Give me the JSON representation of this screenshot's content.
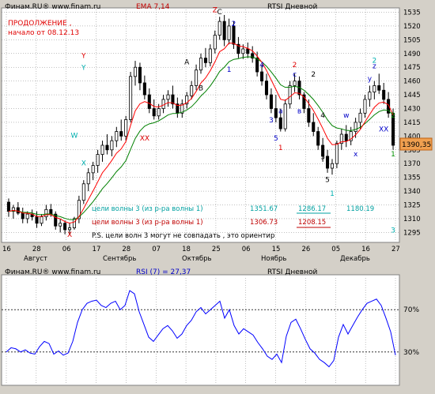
{
  "colors": {
    "panel_bg": "#ffffff",
    "outer_bg": "#d4d0c8",
    "grid": "#808080",
    "candle_stroke": "#000000",
    "candle_up_fill": "#ffffff",
    "ema_fast": "#ff0000",
    "ema_slow": "#008000",
    "rsi_line": "#0000ff",
    "wave_red": "#e00000",
    "wave_blue": "#0000c8",
    "wave_cyan": "#00b0b0",
    "wave_black": "#000000",
    "price_badge_bg": "#f0a050",
    "annotation_red": "#c00000",
    "annotation_cyan": "#00a0a0"
  },
  "price_panel": {
    "source_label": "Финам.RU® www.finam.ru",
    "indicator_label": "EMA 7,14",
    "title": "RTSI Дневной",
    "note_line1": "ПРОДОЛЖЕНИЕ  ,",
    "note_line2": "начало  от 08.12.13",
    "targets_cyan": {
      "label": "цели   волны 3 (из р-ра волны 1)",
      "v1": "1351.67",
      "v2": "1286.17",
      "v3": "1180.19"
    },
    "targets_red": {
      "label": "цели   волны 3 (из р-ра волны 1)",
      "v1": "1306.73",
      "v2": "1208.15"
    },
    "disclaimer": "P.S. цели  волн 3  могут  не  совпадать , это  ориентир",
    "last_price": "1390,35",
    "y_ticks": [
      "1535",
      "1520",
      "1505",
      "1490",
      "1475",
      "1460",
      "1445",
      "1430",
      "1415",
      "1400",
      "1385",
      "1370",
      "1355",
      "1340",
      "1325",
      "1310",
      "1295"
    ],
    "x_ticks_top": [
      "16",
      "28",
      "06",
      "17",
      "28",
      "07",
      "18",
      "25",
      "06",
      "15",
      "26",
      "05",
      "16",
      "27"
    ],
    "months": [
      "Август",
      "Сентябрь",
      "Октябрь",
      "Ноябрь",
      "Декабрь"
    ],
    "wave_labels": [
      {
        "t": "Z",
        "c": "red"
      },
      {
        "t": "C",
        "c": "black"
      },
      {
        "t": "Y",
        "c": "red"
      },
      {
        "t": "Y",
        "c": "cyan"
      },
      {
        "t": "A",
        "c": "black"
      },
      {
        "t": "B",
        "c": "black"
      },
      {
        "t": "2",
        "c": "blue"
      },
      {
        "t": "1",
        "c": "blue"
      },
      {
        "t": "4",
        "c": "blue"
      },
      {
        "t": "3",
        "c": "blue"
      },
      {
        "t": "a",
        "c": "blue"
      },
      {
        "t": "5",
        "c": "blue"
      },
      {
        "t": "1",
        "c": "red"
      },
      {
        "t": "2",
        "c": "red"
      },
      {
        "t": "c",
        "c": "blue"
      },
      {
        "t": "в",
        "c": "blue"
      },
      {
        "t": "2",
        "c": "black"
      },
      {
        "t": "1",
        "c": "black"
      },
      {
        "t": "4",
        "c": "black"
      },
      {
        "t": "3",
        "c": "black"
      },
      {
        "t": "5",
        "c": "black"
      },
      {
        "t": "1",
        "c": "cyan"
      },
      {
        "t": "w",
        "c": "blue"
      },
      {
        "t": "x",
        "c": "blue"
      },
      {
        "t": "y",
        "c": "blue"
      },
      {
        "t": "z",
        "c": "blue"
      },
      {
        "t": "2",
        "c": "cyan"
      },
      {
        "t": "XX",
        "c": "red"
      },
      {
        "t": "XX",
        "c": "blue"
      },
      {
        "t": "W",
        "c": "cyan"
      },
      {
        "t": "X",
        "c": "cyan"
      },
      {
        "t": "X",
        "c": "red"
      },
      {
        "t": "2",
        "c": "green"
      },
      {
        "t": "1",
        "c": "green"
      },
      {
        "t": "3",
        "c": "cyan"
      }
    ]
  },
  "rsi_panel": {
    "source_label": "Финам.RU® www.finam.ru",
    "indicator_label": "RSI (7) = 27,37",
    "title": "RTSI Дневной",
    "level_high": "70%",
    "level_low": "30%"
  },
  "chart_data": [
    {
      "type": "candlestick",
      "title": "RTSI Дневной",
      "indicators": [
        "EMA 7",
        "EMA 14"
      ],
      "ylim": [
        1285,
        1538
      ],
      "grid": true,
      "ohlc": [
        [
          1328,
          1332,
          1312,
          1318
        ],
        [
          1318,
          1325,
          1310,
          1322
        ],
        [
          1322,
          1328,
          1314,
          1316
        ],
        [
          1316,
          1322,
          1305,
          1310
        ],
        [
          1310,
          1318,
          1305,
          1315
        ],
        [
          1315,
          1320,
          1308,
          1312
        ],
        [
          1312,
          1318,
          1300,
          1305
        ],
        [
          1305,
          1315,
          1302,
          1312
        ],
        [
          1312,
          1325,
          1308,
          1320
        ],
        [
          1320,
          1326,
          1312,
          1315
        ],
        [
          1315,
          1318,
          1298,
          1302
        ],
        [
          1302,
          1310,
          1295,
          1305
        ],
        [
          1305,
          1308,
          1293,
          1298
        ],
        [
          1298,
          1305,
          1292,
          1300
        ],
        [
          1300,
          1312,
          1298,
          1310
        ],
        [
          1310,
          1335,
          1305,
          1330
        ],
        [
          1330,
          1352,
          1326,
          1348
        ],
        [
          1348,
          1365,
          1340,
          1360
        ],
        [
          1360,
          1372,
          1352,
          1368
        ],
        [
          1368,
          1385,
          1360,
          1380
        ],
        [
          1380,
          1395,
          1372,
          1390
        ],
        [
          1390,
          1402,
          1380,
          1385
        ],
        [
          1385,
          1400,
          1378,
          1395
        ],
        [
          1395,
          1410,
          1388,
          1405
        ],
        [
          1405,
          1418,
          1395,
          1400
        ],
        [
          1400,
          1422,
          1395,
          1418
        ],
        [
          1418,
          1470,
          1415,
          1465
        ],
        [
          1465,
          1482,
          1455,
          1475
        ],
        [
          1475,
          1480,
          1450,
          1458
        ],
        [
          1458,
          1466,
          1440,
          1445
        ],
        [
          1445,
          1452,
          1425,
          1430
        ],
        [
          1430,
          1440,
          1418,
          1422
        ],
        [
          1422,
          1435,
          1418,
          1430
        ],
        [
          1430,
          1445,
          1425,
          1440
        ],
        [
          1440,
          1450,
          1432,
          1445
        ],
        [
          1445,
          1455,
          1430,
          1435
        ],
        [
          1435,
          1442,
          1420,
          1425
        ],
        [
          1425,
          1440,
          1420,
          1435
        ],
        [
          1435,
          1448,
          1430,
          1444
        ],
        [
          1444,
          1460,
          1440,
          1455
        ],
        [
          1455,
          1478,
          1450,
          1472
        ],
        [
          1472,
          1490,
          1468,
          1485
        ],
        [
          1485,
          1496,
          1475,
          1480
        ],
        [
          1480,
          1500,
          1476,
          1495
        ],
        [
          1495,
          1515,
          1490,
          1510
        ],
        [
          1510,
          1530,
          1505,
          1525
        ],
        [
          1525,
          1532,
          1498,
          1505
        ],
        [
          1505,
          1528,
          1500,
          1520
        ],
        [
          1520,
          1525,
          1495,
          1500
        ],
        [
          1500,
          1508,
          1485,
          1490
        ],
        [
          1490,
          1500,
          1484,
          1495
        ],
        [
          1495,
          1502,
          1485,
          1490
        ],
        [
          1490,
          1498,
          1480,
          1485
        ],
        [
          1485,
          1492,
          1465,
          1470
        ],
        [
          1470,
          1478,
          1455,
          1460
        ],
        [
          1460,
          1468,
          1440,
          1445
        ],
        [
          1445,
          1452,
          1425,
          1430
        ],
        [
          1430,
          1445,
          1415,
          1420
        ],
        [
          1420,
          1430,
          1405,
          1408
        ],
        [
          1408,
          1440,
          1405,
          1435
        ],
        [
          1435,
          1460,
          1430,
          1455
        ],
        [
          1455,
          1468,
          1448,
          1460
        ],
        [
          1460,
          1465,
          1440,
          1445
        ],
        [
          1445,
          1448,
          1425,
          1430
        ],
        [
          1430,
          1440,
          1410,
          1415
        ],
        [
          1415,
          1425,
          1400,
          1405
        ],
        [
          1405,
          1410,
          1385,
          1390
        ],
        [
          1390,
          1398,
          1372,
          1378
        ],
        [
          1378,
          1385,
          1360,
          1365
        ],
        [
          1365,
          1375,
          1358,
          1370
        ],
        [
          1370,
          1395,
          1365,
          1392
        ],
        [
          1392,
          1408,
          1385,
          1402
        ],
        [
          1402,
          1412,
          1388,
          1395
        ],
        [
          1395,
          1410,
          1390,
          1405
        ],
        [
          1405,
          1420,
          1398,
          1415
        ],
        [
          1415,
          1430,
          1408,
          1425
        ],
        [
          1425,
          1445,
          1420,
          1440
        ],
        [
          1440,
          1455,
          1432,
          1448
        ],
        [
          1448,
          1460,
          1440,
          1455
        ],
        [
          1455,
          1468,
          1446,
          1450
        ],
        [
          1450,
          1458,
          1435,
          1440
        ],
        [
          1440,
          1448,
          1420,
          1425
        ],
        [
          1425,
          1430,
          1385,
          1390
        ]
      ]
    },
    {
      "type": "line",
      "title": "RSI (7) = 27,37",
      "ylim": [
        0,
        100
      ],
      "levels": [
        30,
        70
      ],
      "values": [
        30,
        34,
        33,
        30,
        32,
        29,
        28,
        35,
        40,
        38,
        28,
        31,
        27,
        29,
        40,
        58,
        70,
        76,
        78,
        79,
        74,
        72,
        76,
        78,
        70,
        74,
        88,
        85,
        68,
        56,
        44,
        40,
        46,
        52,
        55,
        50,
        43,
        47,
        55,
        60,
        68,
        72,
        66,
        70,
        74,
        78,
        62,
        70,
        55,
        47,
        52,
        49,
        46,
        39,
        33,
        26,
        23,
        28,
        20,
        45,
        58,
        61,
        52,
        42,
        33,
        29,
        23,
        20,
        16,
        22,
        44,
        56,
        47,
        55,
        63,
        70,
        76,
        78,
        80,
        74,
        62,
        49,
        27
      ]
    }
  ]
}
